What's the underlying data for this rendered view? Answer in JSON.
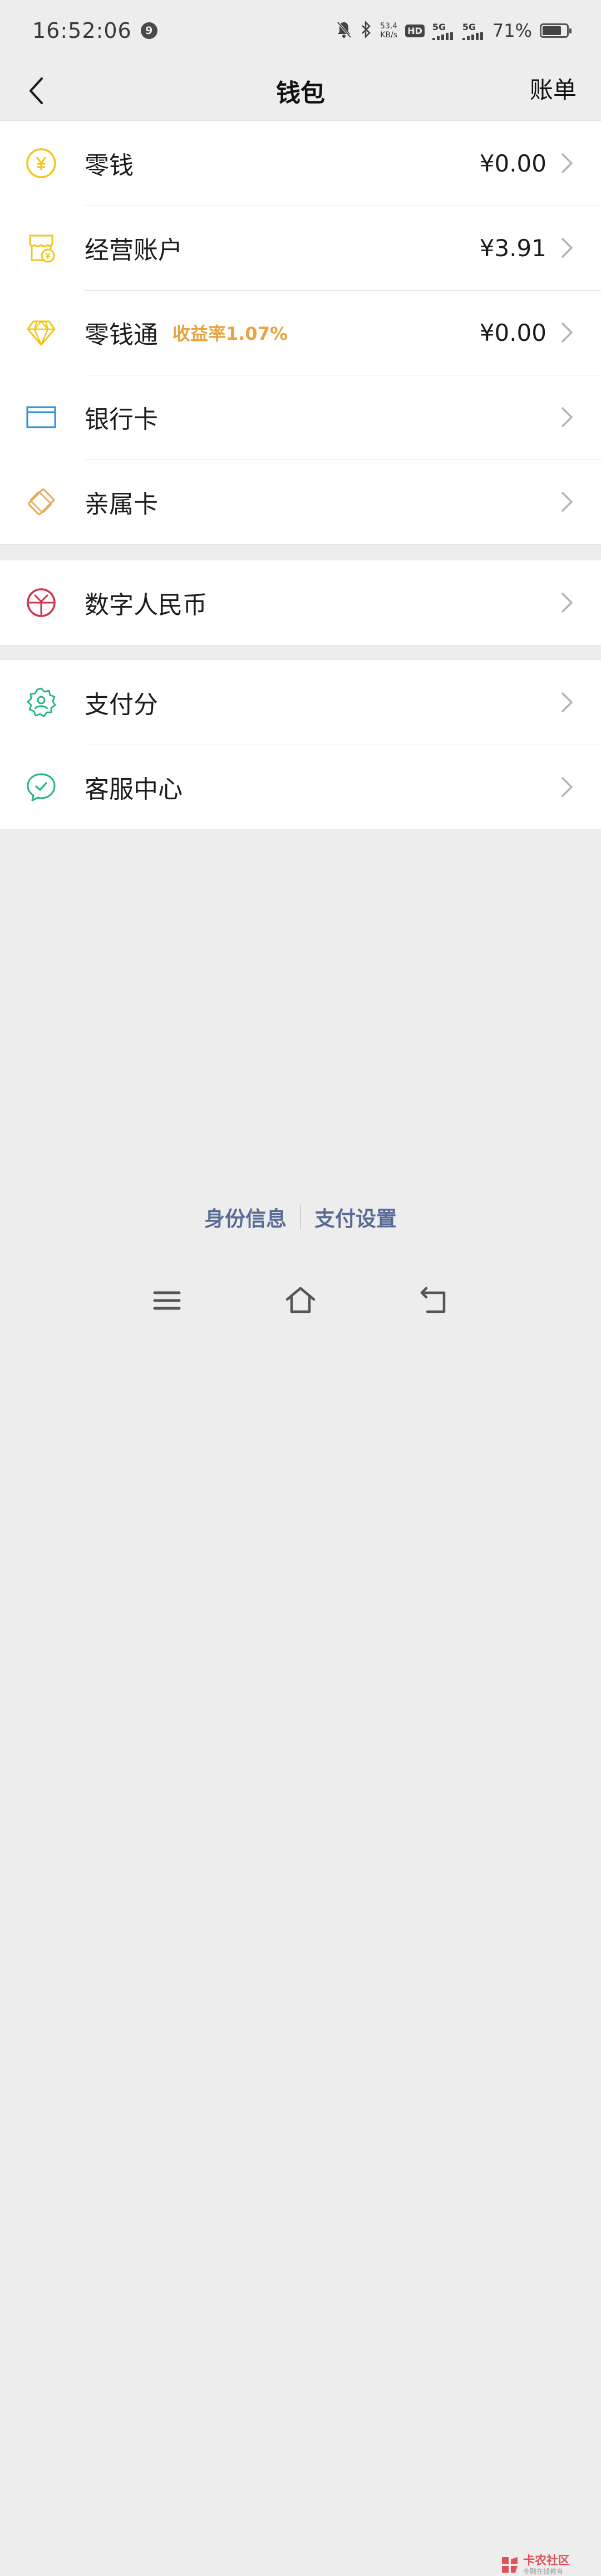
{
  "status_bar": {
    "time": "16:52:06",
    "badge": "9",
    "net_speed_value": "53.4",
    "net_speed_unit": "KB/s",
    "hd_label": "HD",
    "sim1_label": "5G",
    "sim2_label": "5G",
    "battery_text": "71%",
    "battery_level": 0.71
  },
  "nav": {
    "title": "钱包",
    "bill_label": "账单"
  },
  "wallet_group": [
    {
      "label": "零钱",
      "value": "¥0.00",
      "icon": "yuan-coin-icon"
    },
    {
      "label": "经营账户",
      "value": "¥3.91",
      "icon": "business-account-icon"
    },
    {
      "label": "零钱通",
      "tag": "收益率1.07%",
      "value": "¥0.00",
      "icon": "diamond-icon"
    },
    {
      "label": "银行卡",
      "icon": "bank-card-icon"
    },
    {
      "label": "亲属卡",
      "icon": "family-card-icon"
    }
  ],
  "ecny_group": [
    {
      "label": "数字人民币",
      "icon": "digital-rmb-icon"
    }
  ],
  "service_group": [
    {
      "label": "支付分",
      "icon": "pay-score-icon"
    },
    {
      "label": "客服中心",
      "icon": "customer-service-icon"
    }
  ],
  "footer": {
    "identity_label": "身份信息",
    "settings_label": "支付设置"
  },
  "watermark": {
    "title": "卡农社区",
    "subtitle": "金融在线教育"
  },
  "colors": {
    "accent_gold": "#f2c617",
    "tag_orange": "#e6a340",
    "bank_blue": "#2b8fd9",
    "family_orange": "#e8a95a",
    "ecny_red": "#d0344b",
    "service_green": "#23b77f",
    "link_blue": "#576b95"
  }
}
